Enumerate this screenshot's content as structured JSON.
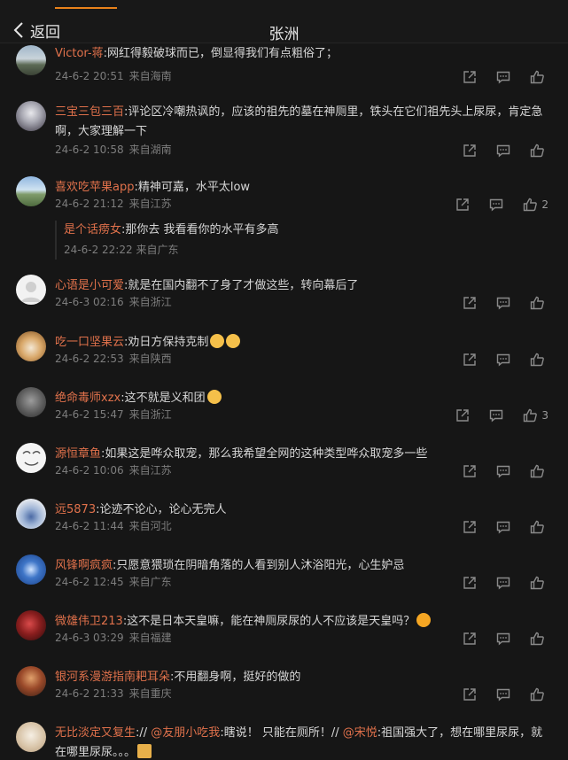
{
  "header": {
    "back_label": "返回",
    "title": "张洲"
  },
  "comments": [
    {
      "user": "Victor-蒋",
      "text": ":网红得毅破球而已，倒显得我们有点粗俗了；",
      "date": "24-6-2 20:51",
      "location": "来自海南",
      "likes": ""
    },
    {
      "user": "三宝三包三百",
      "text": ":评论区冷嘲热讽的，应该的祖先的墓在神厕里，铁头在它们祖先头上尿尿，肯定急啊，大家理解一下",
      "date": "24-6-2 10:58",
      "location": "来自湖南",
      "likes": ""
    },
    {
      "user": "喜欢吃苹果app",
      "text": ":精神可嘉，水平太low",
      "date": "24-6-2 21:12",
      "location": "来自江苏",
      "likes": "2",
      "reply": {
        "user": "是个话痨女",
        "text": ":那你去 我看看你的水平有多高",
        "date": "24-6-2 22:22",
        "location": "来自广东"
      }
    },
    {
      "user": "心语是小可爱",
      "text": ":就是在国内翻不了身了才做这些，转向幕后了",
      "date": "24-6-3 02:16",
      "location": "来自浙江",
      "likes": ""
    },
    {
      "user": "吃一口坚果云",
      "text": ":劝日方保持克制",
      "date": "24-6-2 22:53",
      "location": "来自陕西",
      "likes": ""
    },
    {
      "user": "绝命毒师xzx",
      "text": ":这不就是义和团",
      "date": "24-6-2 15:47",
      "location": "来自浙江",
      "likes": "3"
    },
    {
      "user": "源恒章鱼",
      "text": ":如果这是哗众取宠，那么我希望全网的这种类型哗众取宠多一些",
      "date": "24-6-2 10:06",
      "location": "来自江苏",
      "likes": ""
    },
    {
      "user": "远5873",
      "text": ":论迹不论心，论心无完人",
      "date": "24-6-2 11:44",
      "location": "来自河北",
      "likes": ""
    },
    {
      "user": "风锋啊疯疯",
      "text": ":只愿意猥琐在阴暗角落的人看到别人沐浴阳光，心生妒忌",
      "date": "24-6-2 12:45",
      "location": "来自广东",
      "likes": ""
    },
    {
      "user": "微雄伟卫213",
      "text": ":这不是日本天皇嘛，能在神厕尿尿的人不应该是天皇吗？",
      "date": "24-6-3 03:29",
      "location": "来自福建",
      "likes": ""
    },
    {
      "user": "银河系漫游指南耙耳朵",
      "text": ":不用翻身啊，挺好的做的",
      "date": "24-6-2 21:33",
      "location": "来自重庆",
      "likes": ""
    },
    {
      "user": "无比淡定又复生",
      "text_parts": [
        ":// ",
        "@友朋小吃我",
        ":瞎说！ 只能在厕所！// ",
        "@宋悦",
        ":祖国强大了，想在哪里尿尿，就在哪里尿尿。。。"
      ]
    }
  ],
  "colors": {
    "username": "#e0714b",
    "background": "#161616",
    "accent": "#e8811a"
  }
}
